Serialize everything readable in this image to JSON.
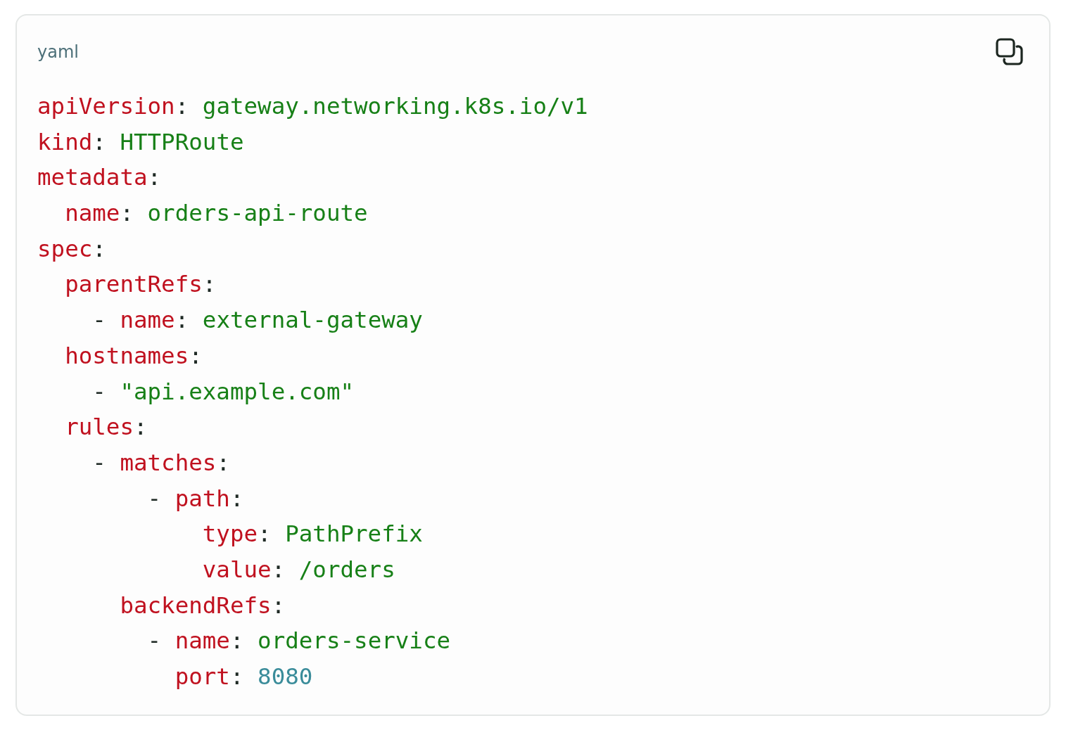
{
  "code_block": {
    "language": "yaml",
    "lines": [
      {
        "tokens": [
          {
            "kind": "key",
            "text": "apiVersion"
          },
          {
            "kind": "punct",
            "text": ": "
          },
          {
            "kind": "string",
            "text": "gateway.networking.k8s.io/v1"
          }
        ]
      },
      {
        "tokens": [
          {
            "kind": "key",
            "text": "kind"
          },
          {
            "kind": "punct",
            "text": ": "
          },
          {
            "kind": "string",
            "text": "HTTPRoute"
          }
        ]
      },
      {
        "tokens": [
          {
            "kind": "key",
            "text": "metadata"
          },
          {
            "kind": "punct",
            "text": ":"
          }
        ]
      },
      {
        "tokens": [
          {
            "kind": "key",
            "text": "  name"
          },
          {
            "kind": "punct",
            "text": ": "
          },
          {
            "kind": "string",
            "text": "orders-api-route"
          }
        ]
      },
      {
        "tokens": [
          {
            "kind": "key",
            "text": "spec"
          },
          {
            "kind": "punct",
            "text": ":"
          }
        ]
      },
      {
        "tokens": [
          {
            "kind": "key",
            "text": "  parentRefs"
          },
          {
            "kind": "punct",
            "text": ":"
          }
        ]
      },
      {
        "tokens": [
          {
            "kind": "punct",
            "text": "    - "
          },
          {
            "kind": "key",
            "text": "name"
          },
          {
            "kind": "punct",
            "text": ": "
          },
          {
            "kind": "string",
            "text": "external-gateway"
          }
        ]
      },
      {
        "tokens": [
          {
            "kind": "key",
            "text": "  hostnames"
          },
          {
            "kind": "punct",
            "text": ":"
          }
        ]
      },
      {
        "tokens": [
          {
            "kind": "punct",
            "text": "    - "
          },
          {
            "kind": "string",
            "text": "\"api.example.com\""
          }
        ]
      },
      {
        "tokens": [
          {
            "kind": "key",
            "text": "  rules"
          },
          {
            "kind": "punct",
            "text": ":"
          }
        ]
      },
      {
        "tokens": [
          {
            "kind": "punct",
            "text": "    - "
          },
          {
            "kind": "key",
            "text": "matches"
          },
          {
            "kind": "punct",
            "text": ":"
          }
        ]
      },
      {
        "tokens": [
          {
            "kind": "punct",
            "text": "        - "
          },
          {
            "kind": "key",
            "text": "path"
          },
          {
            "kind": "punct",
            "text": ":"
          }
        ]
      },
      {
        "tokens": [
          {
            "kind": "key",
            "text": "            type"
          },
          {
            "kind": "punct",
            "text": ": "
          },
          {
            "kind": "string",
            "text": "PathPrefix"
          }
        ]
      },
      {
        "tokens": [
          {
            "kind": "key",
            "text": "            value"
          },
          {
            "kind": "punct",
            "text": ": "
          },
          {
            "kind": "string",
            "text": "/orders"
          }
        ]
      },
      {
        "tokens": [
          {
            "kind": "key",
            "text": "      backendRefs"
          },
          {
            "kind": "punct",
            "text": ":"
          }
        ]
      },
      {
        "tokens": [
          {
            "kind": "punct",
            "text": "        - "
          },
          {
            "kind": "key",
            "text": "name"
          },
          {
            "kind": "punct",
            "text": ": "
          },
          {
            "kind": "string",
            "text": "orders-service"
          }
        ]
      },
      {
        "tokens": [
          {
            "kind": "key",
            "text": "          port"
          },
          {
            "kind": "punct",
            "text": ": "
          },
          {
            "kind": "number",
            "text": "8080"
          }
        ]
      }
    ]
  }
}
